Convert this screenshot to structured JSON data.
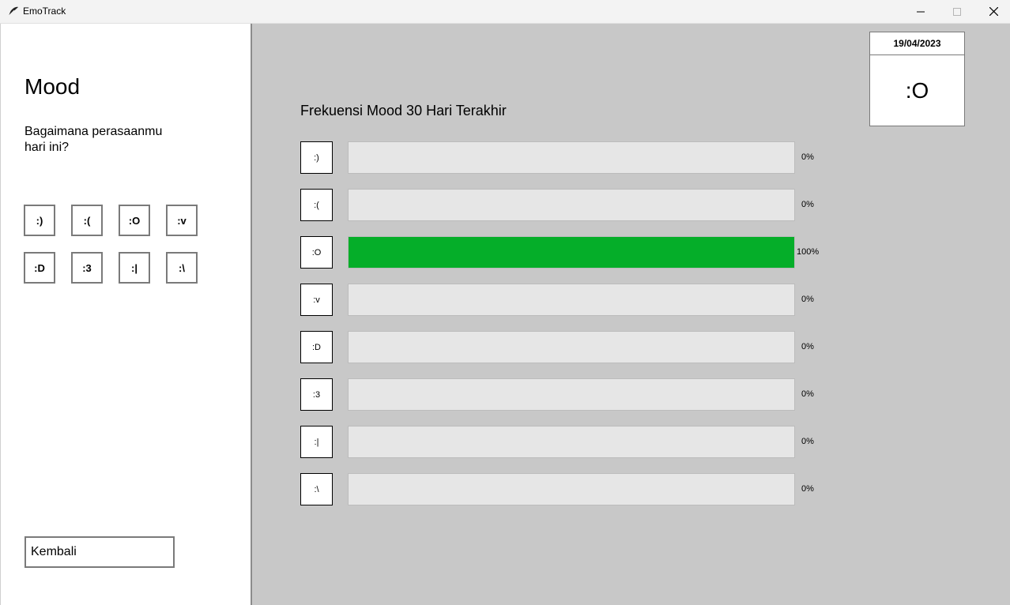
{
  "window": {
    "title": "EmoTrack"
  },
  "left": {
    "title": "Mood",
    "question": "Bagaimana perasaanmu\nhari ini?",
    "moods": [
      ":)",
      ":(",
      ":O",
      ":v",
      ":D",
      ":3",
      ":|",
      ":\\"
    ],
    "back_label": "Kembali"
  },
  "right": {
    "date": "19/04/2023",
    "today_mood": ":O",
    "freq_title": "Frekuensi Mood 30 Hari Terakhir",
    "rows": [
      {
        "emoji": ":)",
        "percent": 0,
        "label": "0%"
      },
      {
        "emoji": ":(",
        "percent": 0,
        "label": "0%"
      },
      {
        "emoji": ":O",
        "percent": 100,
        "label": "100%"
      },
      {
        "emoji": ":v",
        "percent": 0,
        "label": "0%"
      },
      {
        "emoji": ":D",
        "percent": 0,
        "label": "0%"
      },
      {
        "emoji": ":3",
        "percent": 0,
        "label": "0%"
      },
      {
        "emoji": ":|",
        "percent": 0,
        "label": "0%"
      },
      {
        "emoji": ":\\",
        "percent": 0,
        "label": "0%"
      }
    ]
  },
  "colors": {
    "bar_fill": "#05ae29",
    "panel_bg": "#c8c8c8"
  },
  "icons": {
    "app": "feather-icon",
    "minimize": "minimize-icon",
    "maximize": "maximize-icon",
    "close": "close-icon"
  }
}
